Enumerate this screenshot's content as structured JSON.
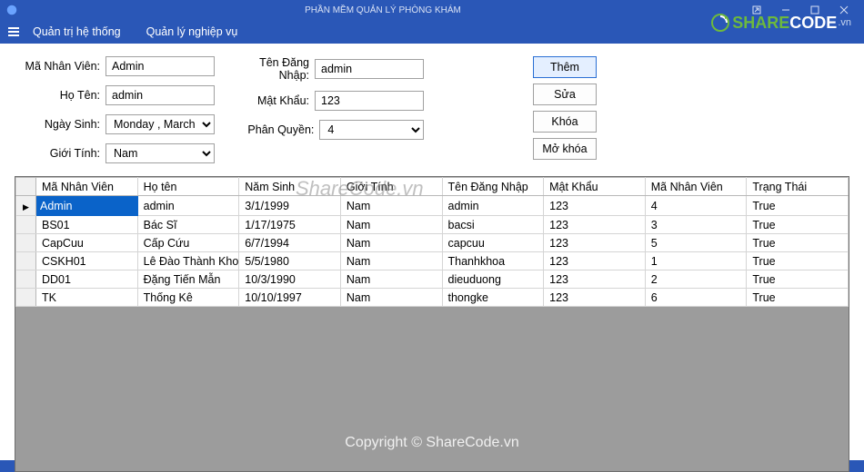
{
  "window": {
    "title": "PHẦN MỀM QUẢN LÝ PHÒNG KHÁM"
  },
  "menu": {
    "item1": "Quản trị hệ thống",
    "item2": "Quản lý nghiệp vụ"
  },
  "labels": {
    "maNV": "Mã Nhân Viên:",
    "hoTen": "Họ Tên:",
    "ngaySinh": "Ngày Sinh:",
    "gioiTinh": "Giới Tính:",
    "tenDN": "Tên Đăng Nhập:",
    "matKhau": "Mật Khẩu:",
    "phanQuyen": "Phân Quyền:"
  },
  "form": {
    "maNV": "Admin",
    "hoTen": "admin",
    "ngaySinh": "Monday  ,   March",
    "gioiTinh": "Nam",
    "tenDN": "admin",
    "matKhau": "123",
    "phanQuyen": "4"
  },
  "buttons": {
    "them": "Thêm",
    "sua": "Sửa",
    "khoa": "Khóa",
    "mokhoa": "Mở khóa"
  },
  "grid": {
    "headers": [
      "Mã Nhân Viên",
      "Họ tên",
      "Năm Sinh",
      "Giới Tính",
      "Tên Đăng Nhập",
      "Mật Khẩu",
      "Mã Nhân Viên",
      "Trạng Thái"
    ],
    "rows": [
      [
        "Admin",
        "admin",
        "3/1/1999",
        "Nam",
        "admin",
        "123",
        "4",
        "True"
      ],
      [
        "BS01",
        "Bác Sĩ",
        "1/17/1975",
        "Nam",
        "bacsi",
        "123",
        "3",
        "True"
      ],
      [
        "CapCuu",
        "Cấp Cứu",
        "6/7/1994",
        "Nam",
        "capcuu",
        "123",
        "5",
        "True"
      ],
      [
        "CSKH01",
        "Lê Đào Thành Khoa",
        "5/5/1980",
        "Nam",
        "Thanhkhoa",
        "123",
        "1",
        "True"
      ],
      [
        "DD01",
        "Đặng Tiến Mẫn",
        "10/3/1990",
        "Nam",
        "dieuduong",
        "123",
        "2",
        "True"
      ],
      [
        "TK",
        "Thống Kê",
        "10/10/1997",
        "Nam",
        "thongke",
        "123",
        "6",
        "True"
      ]
    ]
  },
  "watermark": {
    "center": "ShareCode.vn",
    "bottom": "Copyright © ShareCode.vn"
  },
  "logo": {
    "text1": "SHARE",
    "text2": "CODE",
    "ext": ".vn"
  }
}
